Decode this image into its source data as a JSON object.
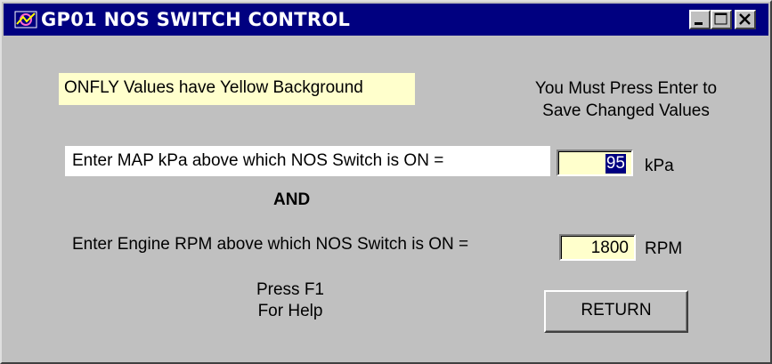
{
  "window": {
    "title": "GP01 NOS SWITCH CONTROL",
    "app_icon": "gp-app-icon",
    "controls": [
      "minimize-icon",
      "maximize-icon",
      "close-icon"
    ]
  },
  "notes": {
    "onfly": "ONFLY Values have Yellow Background",
    "press_enter_line1": "You Must Press Enter to",
    "press_enter_line2": "Save Changed Values",
    "help_line1": "Press F1",
    "help_line2": "For Help"
  },
  "map_setting": {
    "prompt": "Enter MAP kPa above which NOS Switch is ON =",
    "value": "95",
    "unit": "kPa"
  },
  "connector": "AND",
  "rpm_setting": {
    "prompt": "Enter Engine RPM above which NOS Switch is ON =",
    "value": "1800",
    "unit": "RPM"
  },
  "buttons": {
    "return_label": "RETURN"
  },
  "colors": {
    "titlebar": "#000080",
    "window_bg": "#c0c0c0",
    "onfly_yellow": "#ffffcc",
    "selection": "#000080"
  }
}
